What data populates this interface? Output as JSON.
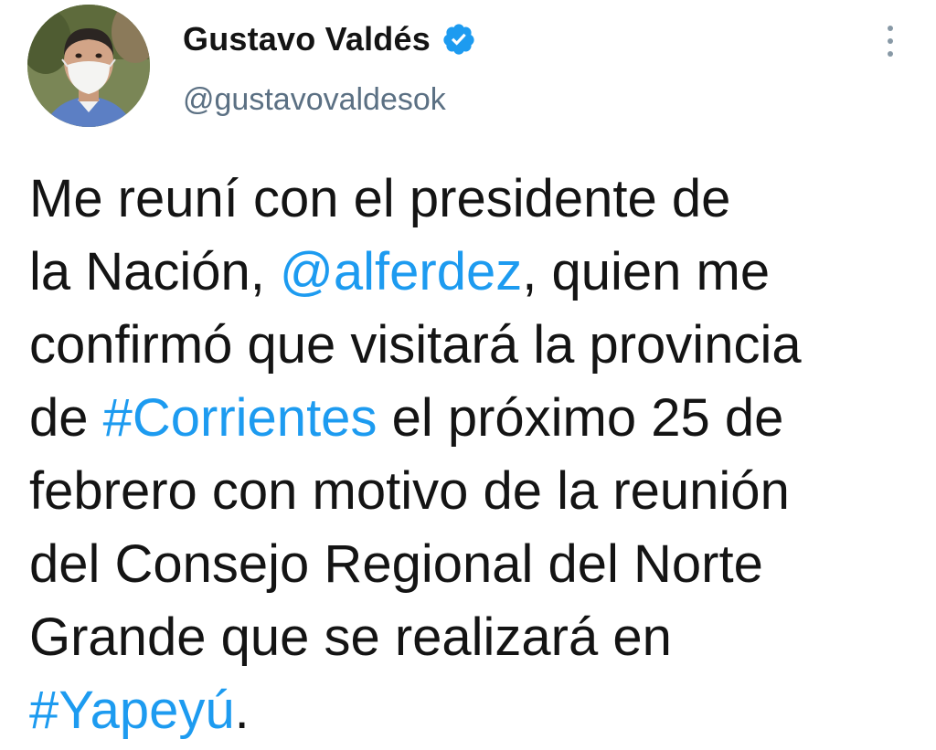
{
  "author": {
    "display_name": "Gustavo Valdés",
    "handle": "@gustavovaldesok",
    "verified": true,
    "avatar_icon": "profile-photo"
  },
  "menu": {
    "icon": "vertical-ellipsis-icon"
  },
  "tweet": {
    "lines": [
      [
        {
          "text": "Me reuní con el presidente de",
          "type": "text"
        }
      ],
      [
        {
          "text": "la Nación, ",
          "type": "text"
        },
        {
          "text": "@alferdez",
          "type": "mention"
        },
        {
          "text": ", quien me",
          "type": "text"
        }
      ],
      [
        {
          "text": "confirmó que visitará la provincia",
          "type": "text"
        }
      ],
      [
        {
          "text": "de ",
          "type": "text"
        },
        {
          "text": "#Corrientes",
          "type": "hashtag"
        },
        {
          "text": " el próximo 25 de",
          "type": "text"
        }
      ],
      [
        {
          "text": "febrero con motivo de la reunión",
          "type": "text"
        }
      ],
      [
        {
          "text": "del Consejo Regional del Norte",
          "type": "text"
        }
      ],
      [
        {
          "text": "Grande que se realizará en",
          "type": "text"
        }
      ],
      [
        {
          "text": "#Yapeyú",
          "type": "hashtag"
        },
        {
          "text": ".",
          "type": "text"
        }
      ]
    ]
  },
  "colors": {
    "link": "#1d9bf0",
    "text": "#141414",
    "secondary": "#5b7083",
    "verified": "#1d9bf0"
  }
}
